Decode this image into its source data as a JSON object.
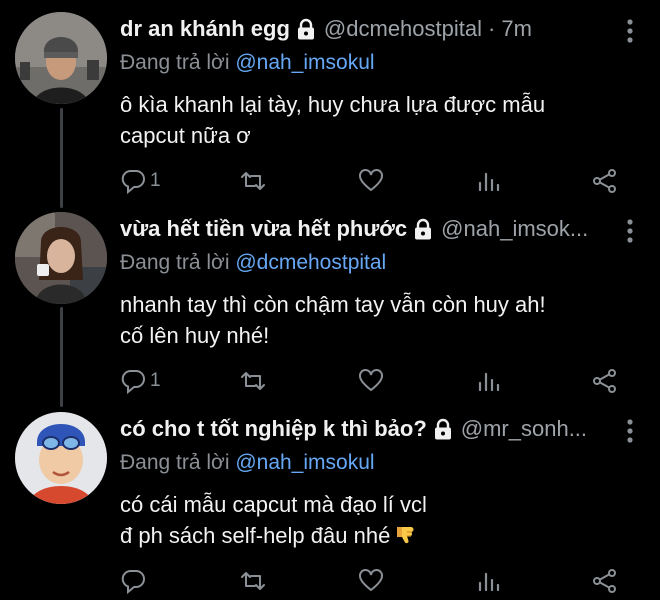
{
  "tweets": [
    {
      "display_name": "dr an khánh egg",
      "handle": "@dcmehostpital",
      "separator": "·",
      "time": "7m",
      "replying_prefix": "Đang trả lời",
      "replying_to": "@nah_imsokul",
      "body_lines": [
        "ô kìa khanh lại tày, huy chưa lựa được mẫu",
        "capcut nữa ơ"
      ],
      "reply_count": "1",
      "avatar_colors": {
        "bg": "#8d8a86",
        "skin": "#c79a7b",
        "hat": "#4a4a4a"
      }
    },
    {
      "display_name": "vừa hết tiền vừa hết phước",
      "handle": "@nah_imsok...",
      "separator": "",
      "time": "",
      "replying_prefix": "Đang trả lời",
      "replying_to": "@dcmehostpital",
      "body_lines": [
        "nhanh tay thì còn chậm tay vẫn còn huy ah!",
        "cố lên huy nhé!"
      ],
      "reply_count": "1",
      "avatar_colors": {
        "bg": "#5c5450",
        "skin": "#d8b49c",
        "hair": "#3a2418"
      }
    },
    {
      "display_name": "có cho t tốt nghiệp k thì bảo?",
      "handle": "@mr_sonh...",
      "separator": "",
      "time": "",
      "replying_prefix": "Đang trả lời",
      "replying_to": "@nah_imsokul",
      "body_lines": [
        "có cái mẫu capcut mà đạo lí vcl",
        "đ ph sách self-help đâu nhé"
      ],
      "reply_count": "",
      "emoji": "thumbs-down",
      "avatar_colors": {
        "bg": "#e4e6ea",
        "skin": "#f0c9a5",
        "hat": "#2f55b8"
      }
    }
  ],
  "icons": {
    "reply": "reply-icon",
    "retweet": "retweet-icon",
    "like": "heart-icon",
    "views": "views-icon",
    "share": "share-icon",
    "more": "more-icon",
    "lock": "lock-icon"
  },
  "colors": {
    "background": "#000000",
    "text": "#e7e9ea",
    "secondary": "#8b9096",
    "mention": "#66a8f5",
    "thread_line": "#3d4145"
  }
}
